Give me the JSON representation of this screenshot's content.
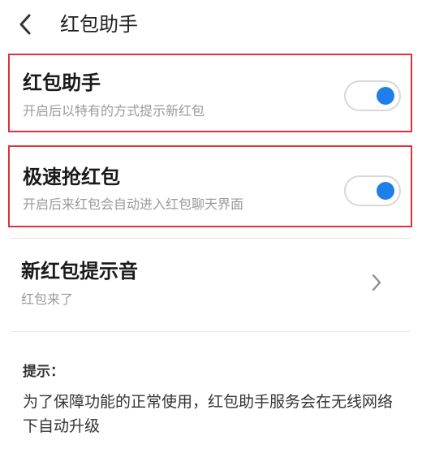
{
  "header": {
    "title": "红包助手",
    "back_icon": "chevron-left-icon"
  },
  "settings": [
    {
      "title": "红包助手",
      "subtitle": "开启后以特有的方式提示新红包",
      "control": "toggle",
      "enabled": true
    },
    {
      "title": "极速抢红包",
      "subtitle": "开启后来红包会自动进入红包聊天界面",
      "control": "toggle",
      "enabled": true
    },
    {
      "title": "新红包提示音",
      "subtitle": "红包来了",
      "control": "chevron-right-icon"
    }
  ],
  "tips": {
    "label": "提示：",
    "text": "为了保障功能的正常使用，红包助手服务会在无线网络下自动升级"
  },
  "colors": {
    "accent": "#1f7fe8",
    "highlight_border": "#e0303a",
    "subtitle": "#9a9a9a",
    "toggle_border": "#d8d8d8"
  }
}
